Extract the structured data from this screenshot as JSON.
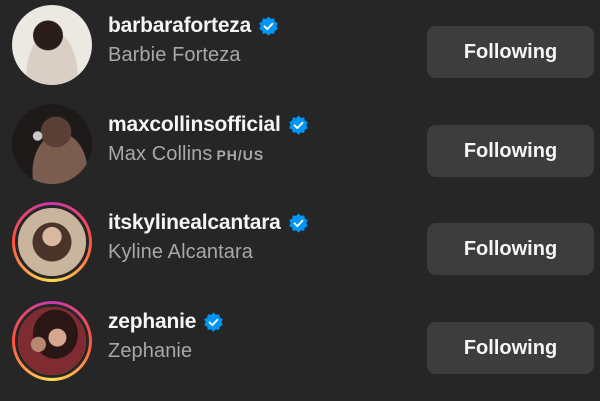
{
  "accounts": [
    {
      "username": "barbaraforteza",
      "full_name": "Barbie Forteza",
      "pronoun": "",
      "verified": true,
      "story_ring": false,
      "button_label": "Following",
      "avatar_color": "#e8e4df"
    },
    {
      "username": "maxcollinsofficial",
      "full_name": "Max Collins",
      "pronoun": "PH/US",
      "verified": true,
      "story_ring": false,
      "button_label": "Following",
      "avatar_color": "#3a302c"
    },
    {
      "username": "itskylinealcantara",
      "full_name": "Kyline Alcantara",
      "pronoun": "",
      "verified": true,
      "story_ring": true,
      "button_label": "Following",
      "avatar_color": "#b8a08a"
    },
    {
      "username": "zephanie",
      "full_name": "Zephanie",
      "pronoun": "",
      "verified": true,
      "story_ring": true,
      "button_label": "Following",
      "avatar_color": "#7a2a2e"
    }
  ],
  "colors": {
    "background": "#262626",
    "button": "#3d3d3d",
    "verified": "#0095f6",
    "secondary_text": "#a8a8a8"
  },
  "icons": {
    "verified": "verified-badge-icon"
  }
}
